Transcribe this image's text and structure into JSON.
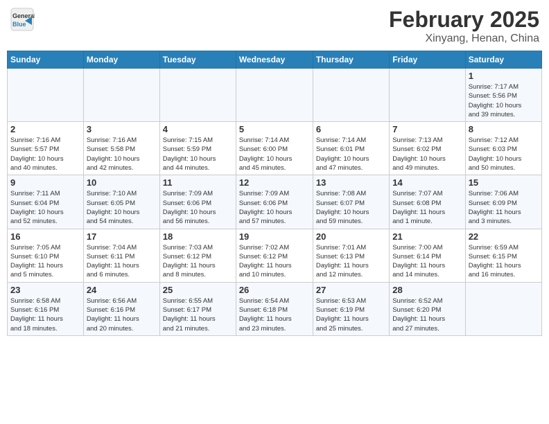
{
  "header": {
    "logo_general": "General",
    "logo_blue": "Blue",
    "month_title": "February 2025",
    "location": "Xinyang, Henan, China"
  },
  "weekdays": [
    "Sunday",
    "Monday",
    "Tuesday",
    "Wednesday",
    "Thursday",
    "Friday",
    "Saturday"
  ],
  "weeks": [
    [
      {
        "day": "",
        "info": ""
      },
      {
        "day": "",
        "info": ""
      },
      {
        "day": "",
        "info": ""
      },
      {
        "day": "",
        "info": ""
      },
      {
        "day": "",
        "info": ""
      },
      {
        "day": "",
        "info": ""
      },
      {
        "day": "1",
        "info": "Sunrise: 7:17 AM\nSunset: 5:56 PM\nDaylight: 10 hours\nand 39 minutes."
      }
    ],
    [
      {
        "day": "2",
        "info": "Sunrise: 7:16 AM\nSunset: 5:57 PM\nDaylight: 10 hours\nand 40 minutes."
      },
      {
        "day": "3",
        "info": "Sunrise: 7:16 AM\nSunset: 5:58 PM\nDaylight: 10 hours\nand 42 minutes."
      },
      {
        "day": "4",
        "info": "Sunrise: 7:15 AM\nSunset: 5:59 PM\nDaylight: 10 hours\nand 44 minutes."
      },
      {
        "day": "5",
        "info": "Sunrise: 7:14 AM\nSunset: 6:00 PM\nDaylight: 10 hours\nand 45 minutes."
      },
      {
        "day": "6",
        "info": "Sunrise: 7:14 AM\nSunset: 6:01 PM\nDaylight: 10 hours\nand 47 minutes."
      },
      {
        "day": "7",
        "info": "Sunrise: 7:13 AM\nSunset: 6:02 PM\nDaylight: 10 hours\nand 49 minutes."
      },
      {
        "day": "8",
        "info": "Sunrise: 7:12 AM\nSunset: 6:03 PM\nDaylight: 10 hours\nand 50 minutes."
      }
    ],
    [
      {
        "day": "9",
        "info": "Sunrise: 7:11 AM\nSunset: 6:04 PM\nDaylight: 10 hours\nand 52 minutes."
      },
      {
        "day": "10",
        "info": "Sunrise: 7:10 AM\nSunset: 6:05 PM\nDaylight: 10 hours\nand 54 minutes."
      },
      {
        "day": "11",
        "info": "Sunrise: 7:09 AM\nSunset: 6:06 PM\nDaylight: 10 hours\nand 56 minutes."
      },
      {
        "day": "12",
        "info": "Sunrise: 7:09 AM\nSunset: 6:06 PM\nDaylight: 10 hours\nand 57 minutes."
      },
      {
        "day": "13",
        "info": "Sunrise: 7:08 AM\nSunset: 6:07 PM\nDaylight: 10 hours\nand 59 minutes."
      },
      {
        "day": "14",
        "info": "Sunrise: 7:07 AM\nSunset: 6:08 PM\nDaylight: 11 hours\nand 1 minute."
      },
      {
        "day": "15",
        "info": "Sunrise: 7:06 AM\nSunset: 6:09 PM\nDaylight: 11 hours\nand 3 minutes."
      }
    ],
    [
      {
        "day": "16",
        "info": "Sunrise: 7:05 AM\nSunset: 6:10 PM\nDaylight: 11 hours\nand 5 minutes."
      },
      {
        "day": "17",
        "info": "Sunrise: 7:04 AM\nSunset: 6:11 PM\nDaylight: 11 hours\nand 6 minutes."
      },
      {
        "day": "18",
        "info": "Sunrise: 7:03 AM\nSunset: 6:12 PM\nDaylight: 11 hours\nand 8 minutes."
      },
      {
        "day": "19",
        "info": "Sunrise: 7:02 AM\nSunset: 6:12 PM\nDaylight: 11 hours\nand 10 minutes."
      },
      {
        "day": "20",
        "info": "Sunrise: 7:01 AM\nSunset: 6:13 PM\nDaylight: 11 hours\nand 12 minutes."
      },
      {
        "day": "21",
        "info": "Sunrise: 7:00 AM\nSunset: 6:14 PM\nDaylight: 11 hours\nand 14 minutes."
      },
      {
        "day": "22",
        "info": "Sunrise: 6:59 AM\nSunset: 6:15 PM\nDaylight: 11 hours\nand 16 minutes."
      }
    ],
    [
      {
        "day": "23",
        "info": "Sunrise: 6:58 AM\nSunset: 6:16 PM\nDaylight: 11 hours\nand 18 minutes."
      },
      {
        "day": "24",
        "info": "Sunrise: 6:56 AM\nSunset: 6:16 PM\nDaylight: 11 hours\nand 20 minutes."
      },
      {
        "day": "25",
        "info": "Sunrise: 6:55 AM\nSunset: 6:17 PM\nDaylight: 11 hours\nand 21 minutes."
      },
      {
        "day": "26",
        "info": "Sunrise: 6:54 AM\nSunset: 6:18 PM\nDaylight: 11 hours\nand 23 minutes."
      },
      {
        "day": "27",
        "info": "Sunrise: 6:53 AM\nSunset: 6:19 PM\nDaylight: 11 hours\nand 25 minutes."
      },
      {
        "day": "28",
        "info": "Sunrise: 6:52 AM\nSunset: 6:20 PM\nDaylight: 11 hours\nand 27 minutes."
      },
      {
        "day": "",
        "info": ""
      }
    ]
  ]
}
